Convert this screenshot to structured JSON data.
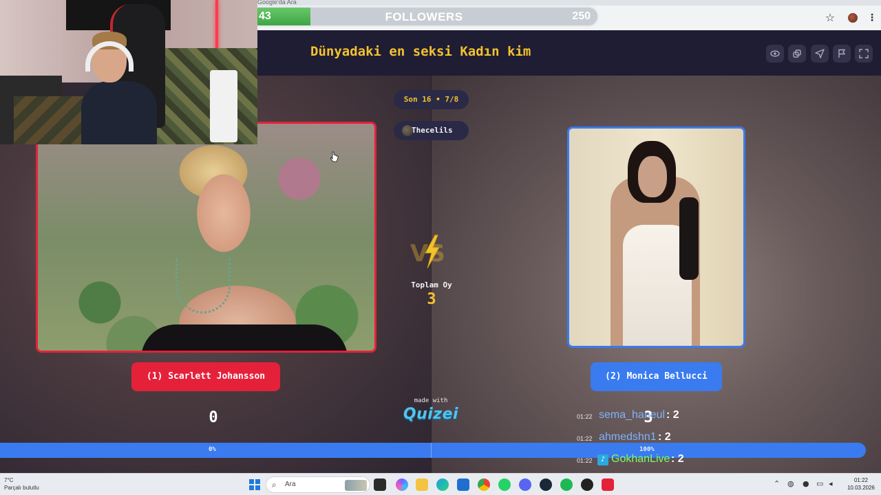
{
  "browser": {
    "tab_text": "Google'da Ara",
    "star_icon": "star-icon",
    "menu_icon": "kebab-menu-icon"
  },
  "followers_overlay": {
    "current": "43",
    "label": "FOLLOWERS",
    "goal": "250",
    "progress_fraction": 0.172
  },
  "header": {
    "title": "Dünyadaki en seksi Kadın kim",
    "icons": [
      "eye-icon",
      "share-icon",
      "send-icon",
      "flag-icon",
      "fullscreen-icon"
    ]
  },
  "round": {
    "label": "Son 16 • 7/8",
    "creator": "Thecelils"
  },
  "left_choice": {
    "label": "(1) Scarlett Johansson",
    "votes": "0",
    "percent": "0%",
    "color": "#e5213a"
  },
  "right_choice": {
    "label": "(2) Monica Bellucci",
    "votes": "3",
    "percent": "100%",
    "color": "#3a7bf0"
  },
  "center": {
    "vs": "VS",
    "total_label": "Toplam Oy",
    "total_value": "3",
    "made_with": "made with",
    "brand": "Quizei"
  },
  "chat": [
    {
      "time": "01:22",
      "user": "sema_haneul",
      "message": ": 2"
    },
    {
      "time": "01:22",
      "user": "ahmedshn1",
      "message": ": 2"
    },
    {
      "time": "01:22",
      "user": "GokhanLive",
      "message": ": 2"
    }
  ],
  "taskbar": {
    "weather_temp": "7°C",
    "weather_desc": "Parçalı bulutlu",
    "search_placeholder": "Ara",
    "time": "01:22",
    "date": "10.03.2026"
  }
}
